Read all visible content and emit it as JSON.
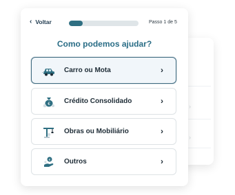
{
  "header": {
    "back_label": "Voltar",
    "step_text": "Passo 1 de 5",
    "progress": 0.2
  },
  "title": "Como podemos ajudar?",
  "options": [
    {
      "label": "Carro ou Mota",
      "icon": "car-icon",
      "selected": true
    },
    {
      "label": "Crédito Consolidado",
      "icon": "money-bag-icon",
      "selected": false
    },
    {
      "label": "Obras ou Mobiliário",
      "icon": "crane-icon",
      "selected": false
    },
    {
      "label": "Outros",
      "icon": "hand-coin-icon",
      "selected": false
    }
  ],
  "colors": {
    "accent": "#2a6d86",
    "progress_fill": "#2f6f82",
    "progress_track": "#dfe5e8",
    "selected_border": "#3f6a80",
    "selected_bg": "#f1f6fa"
  }
}
